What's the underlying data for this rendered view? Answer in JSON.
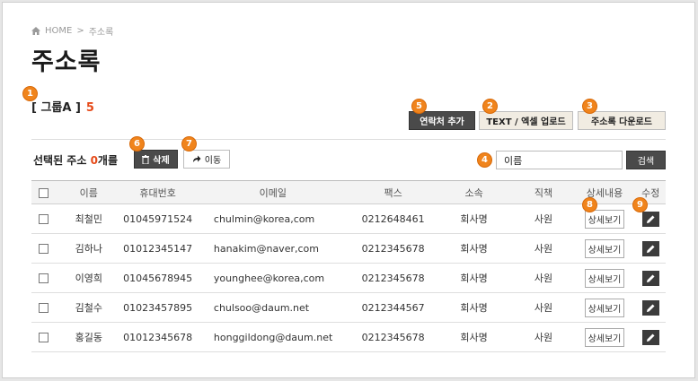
{
  "breadcrumb": {
    "home": "HOME",
    "sep": ">",
    "current": "주소록"
  },
  "page_title": "주소록",
  "group": {
    "name": "[ 그룹A ]",
    "count": "5"
  },
  "badges": [
    "1",
    "2",
    "3",
    "4",
    "5",
    "6",
    "7",
    "8",
    "9"
  ],
  "toolbar": {
    "add_contact": "연락처 추가",
    "upload": "TEXT / 엑셀 업로드",
    "download": "주소록 다운로드",
    "delete": "삭제",
    "move": "이동",
    "search_value": "이름",
    "search_btn": "검색"
  },
  "selected": {
    "prefix": "선택된 주소 ",
    "count": "0",
    "suffix": "개를"
  },
  "table": {
    "headers": [
      "이름",
      "휴대번호",
      "이메일",
      "팩스",
      "소속",
      "직책",
      "상세내용",
      "수정"
    ],
    "detail_label": "상세보기",
    "rows": [
      {
        "name": "최철민",
        "mobile": "01045971524",
        "email": "chulmin@korea,com",
        "fax": "0212648461",
        "org": "회사명",
        "pos": "사원"
      },
      {
        "name": "김하나",
        "mobile": "01012345147",
        "email": "hanakim@naver,com",
        "fax": "0212345678",
        "org": "회사명",
        "pos": "사원"
      },
      {
        "name": "이영희",
        "mobile": "01045678945",
        "email": "younghee@korea,com",
        "fax": "0212345678",
        "org": "회사명",
        "pos": "사원"
      },
      {
        "name": "김철수",
        "mobile": "01023457895",
        "email": "chulsoo@daum.net",
        "fax": "0212344567",
        "org": "회사명",
        "pos": "사원"
      },
      {
        "name": "홍길동",
        "mobile": "01012345678",
        "email": "honggildong@daum.net",
        "fax": "0212345678",
        "org": "회사명",
        "pos": "사원"
      }
    ]
  },
  "colors": {
    "accent": "#e64a19",
    "badge": "#f0841c",
    "dark_button": "#4a4a4a"
  }
}
